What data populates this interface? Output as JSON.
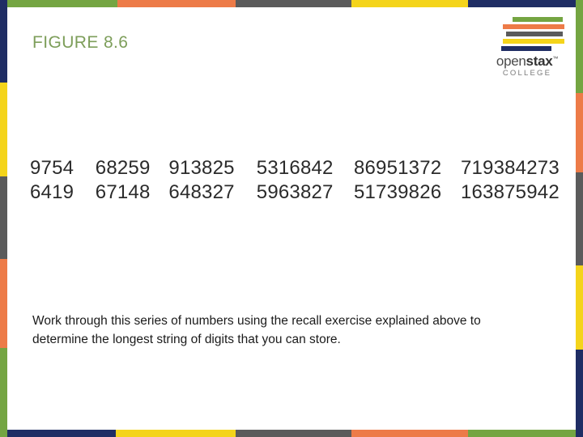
{
  "slide": {
    "title": "FIGURE 8.6",
    "title_color": "#7d9e5a",
    "background_color": "#ffffff"
  },
  "logo": {
    "wordmark_light_1": "open",
    "wordmark_bold": "stax",
    "trademark": "™",
    "subtitle": "COLLEGE",
    "bars": [
      {
        "name": "green-bar",
        "color": "#74a542"
      },
      {
        "name": "orange-bar",
        "color": "#ed7b48"
      },
      {
        "name": "gray-bar",
        "color": "#5b5b5b"
      },
      {
        "name": "yellow-bar",
        "color": "#f4d41b"
      },
      {
        "name": "navy-bar",
        "color": "#1f2d64"
      }
    ]
  },
  "border": {
    "top": [
      {
        "color": "#74a542",
        "start": 0,
        "end": 145
      },
      {
        "color": "#ed7b48",
        "start": 145,
        "end": 291
      },
      {
        "color": "#5b5b5b",
        "start": 291,
        "end": 434
      },
      {
        "color": "#f4d41b",
        "start": 434,
        "end": 578
      },
      {
        "color": "#1f2d64",
        "start": 578,
        "end": 720
      }
    ],
    "bottom": [
      {
        "color": "#1f2d64",
        "start": 0,
        "end": 143
      },
      {
        "color": "#f4d41b",
        "start": 143,
        "end": 291
      },
      {
        "color": "#5b5b5b",
        "start": 291,
        "end": 434
      },
      {
        "color": "#ed7b48",
        "start": 434,
        "end": 578
      },
      {
        "color": "#74a542",
        "start": 578,
        "end": 720
      }
    ],
    "left": [
      {
        "color": "#1f2d64",
        "start": 0,
        "end": 102
      },
      {
        "color": "#f4d41b",
        "start": 102,
        "end": 218
      },
      {
        "color": "#5b5b5b",
        "start": 218,
        "end": 320
      },
      {
        "color": "#ed7b48",
        "start": 320,
        "end": 430
      },
      {
        "color": "#74a542",
        "start": 430,
        "end": 540
      }
    ],
    "right": [
      {
        "color": "#74a542",
        "start": 0,
        "end": 115
      },
      {
        "color": "#ed7b48",
        "start": 115,
        "end": 213
      },
      {
        "color": "#5b5b5b",
        "start": 213,
        "end": 328
      },
      {
        "color": "#f4d41b",
        "start": 328,
        "end": 432
      },
      {
        "color": "#1f2d64",
        "start": 432,
        "end": 540
      }
    ]
  },
  "numbers": {
    "rows": [
      [
        "9754",
        "68259",
        "913825",
        "5316842",
        "86951372",
        "719384273"
      ],
      [
        "6419",
        "67148",
        "648327",
        "5963827",
        "51739826",
        "163875942"
      ]
    ]
  },
  "caption": {
    "text": "Work through this series of numbers using the recall exercise explained above to determine the longest string of digits that you can store."
  }
}
